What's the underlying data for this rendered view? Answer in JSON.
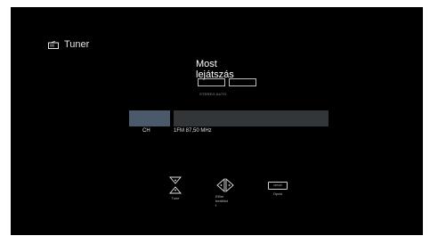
{
  "header": {
    "title": "Tuner",
    "icon": "radio-icon"
  },
  "now_playing": {
    "title_line1": "Most",
    "title_line2": "lejátszás",
    "mode_label": "STEREO AUTO"
  },
  "station": {
    "ch_label": "CH",
    "frequency_label": "1FM 87,50 MHz"
  },
  "controls": {
    "tune_label": "Tune",
    "preset_label_lines": [
      "Előre",
      "beállítot",
      "t"
    ],
    "option_key_text": "OPCIÓ",
    "option_label": "Opció"
  },
  "colors": {
    "background": "#000000",
    "ch_block": "#4b5a6b",
    "frequency_bar": "#333638",
    "text": "#ffffff"
  }
}
